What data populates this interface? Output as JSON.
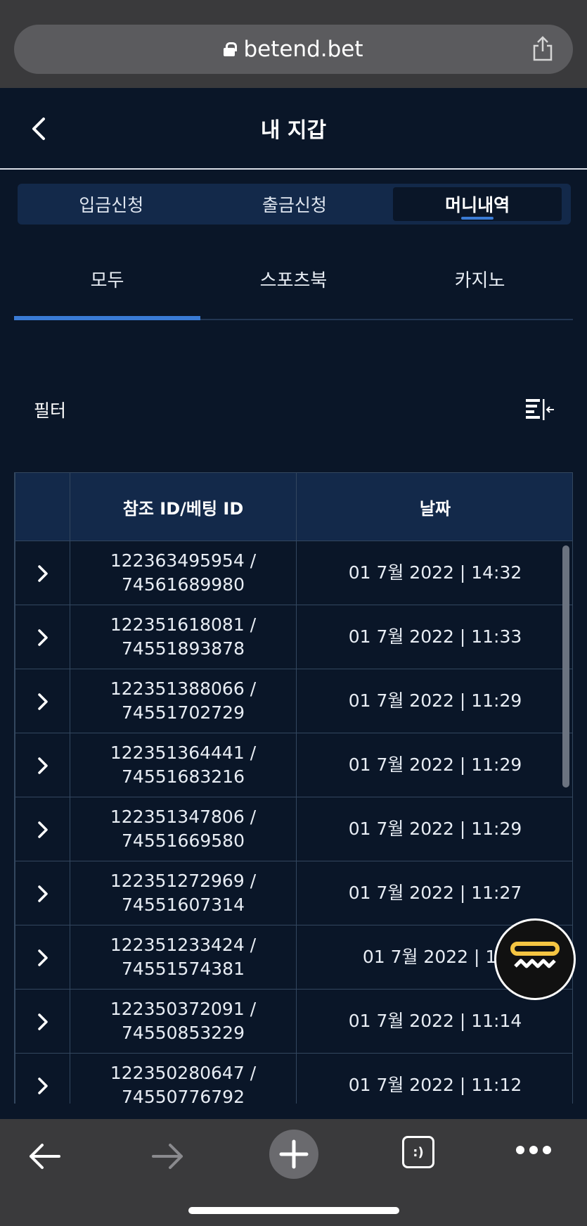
{
  "browser": {
    "url": "betend.bet"
  },
  "header": {
    "title": "내 지갑"
  },
  "top_tabs": [
    {
      "label": "입금신청",
      "active": false
    },
    {
      "label": "출금신청",
      "active": false
    },
    {
      "label": "머니내역",
      "active": true
    }
  ],
  "sub_tabs": [
    {
      "label": "모두",
      "active": true
    },
    {
      "label": "스포츠북",
      "active": false
    },
    {
      "label": "카지노",
      "active": false
    }
  ],
  "filter": {
    "label": "필터"
  },
  "table": {
    "columns": [
      "",
      "참조 ID/베팅 ID",
      "날짜"
    ],
    "rows": [
      {
        "ref": "122363495954 /",
        "bet": "74561689980",
        "date": "01 7월 2022 | 14:32"
      },
      {
        "ref": "122351618081 /",
        "bet": "74551893878",
        "date": "01 7월 2022 | 11:33"
      },
      {
        "ref": "122351388066 /",
        "bet": "74551702729",
        "date": "01 7월 2022 | 11:29"
      },
      {
        "ref": "122351364441 /",
        "bet": "74551683216",
        "date": "01 7월 2022 | 11:29"
      },
      {
        "ref": "122351347806 /",
        "bet": "74551669580",
        "date": "01 7월 2022 | 11:29"
      },
      {
        "ref": "122351272969 /",
        "bet": "74551607314",
        "date": "01 7월 2022 | 11:27"
      },
      {
        "ref": "122351233424 /",
        "bet": "74551574381",
        "date": "01 7월 2022 | 11"
      },
      {
        "ref": "122350372091 /",
        "bet": "74550853229",
        "date": "01 7월 2022 | 11:14"
      },
      {
        "ref": "122350280647 /",
        "bet": "74550776792",
        "date": "01 7월 2022 | 11:12"
      }
    ]
  },
  "browser_bottom": {
    "tabs_label": ":)"
  },
  "colors": {
    "background": "#0a1628",
    "accent": "#3a7bd5",
    "header_cell": "#13294a",
    "chat_yellow": "#f5c542"
  },
  "icons": {
    "back": "chevron-left-icon",
    "share": "share-icon",
    "lock": "lock-icon",
    "filter": "filter-sort-icon",
    "row_expand": "chevron-right-icon",
    "chat": "chat-support-icon",
    "browser_back": "arrow-left-icon",
    "browser_forward": "arrow-right-icon",
    "browser_new_tab": "plus-icon",
    "browser_tabs": "tabs-icon",
    "browser_more": "more-icon"
  }
}
